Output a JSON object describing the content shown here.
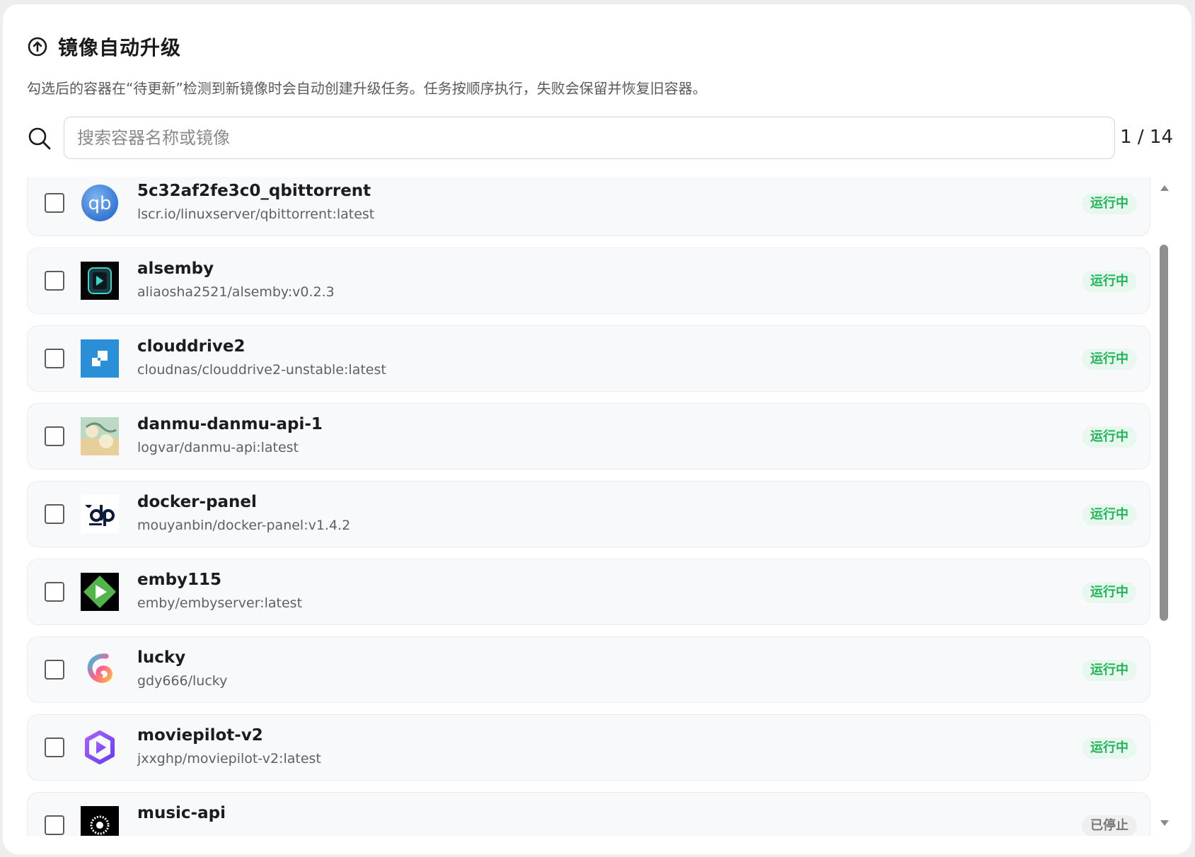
{
  "header": {
    "title": "镜像自动升级",
    "description": "勾选后的容器在“待更新”检测到新镜像时会自动创建升级任务。任务按顺序执行，失败会保留并恢复旧容器。"
  },
  "search": {
    "placeholder": "搜索容器名称或镜像",
    "value": "",
    "count": "1 / 14"
  },
  "containers": [
    {
      "name": "5c32af2fe3c0_qbittorrent",
      "image": "lscr.io/linuxserver/qbittorrent:latest",
      "status": "运行中",
      "icon": "qbittorrent-logo",
      "checked": false
    },
    {
      "name": "alsemby",
      "image": "aliaosha2521/alsemby:v0.2.3",
      "status": "运行中",
      "icon": "alsemby-logo",
      "checked": false
    },
    {
      "name": "clouddrive2",
      "image": "cloudnas/clouddrive2-unstable:latest",
      "status": "运行中",
      "icon": "clouddrive2-logo",
      "checked": false
    },
    {
      "name": "danmu-danmu-api-1",
      "image": "logvar/danmu-api:latest",
      "status": "运行中",
      "icon": "danmu-api-logo",
      "checked": false
    },
    {
      "name": "docker-panel",
      "image": "mouyanbin/docker-panel:v1.4.2",
      "status": "运行中",
      "icon": "docker-panel-logo",
      "checked": false
    },
    {
      "name": "emby115",
      "image": "emby/embyserver:latest",
      "status": "运行中",
      "icon": "emby-logo",
      "checked": false
    },
    {
      "name": "lucky",
      "image": "gdy666/lucky",
      "status": "运行中",
      "icon": "lucky-logo",
      "checked": false
    },
    {
      "name": "moviepilot-v2",
      "image": "jxxghp/moviepilot-v2:latest",
      "status": "运行中",
      "icon": "moviepilot-logo",
      "checked": false
    },
    {
      "name": "music-api",
      "image": "",
      "status": "已停止",
      "icon": "music-api-logo",
      "checked": false
    }
  ],
  "colors": {
    "running_text": "#22b45a",
    "running_bg": "#e9f8ee",
    "stopped_text": "#777777",
    "stopped_bg": "#efefef"
  }
}
